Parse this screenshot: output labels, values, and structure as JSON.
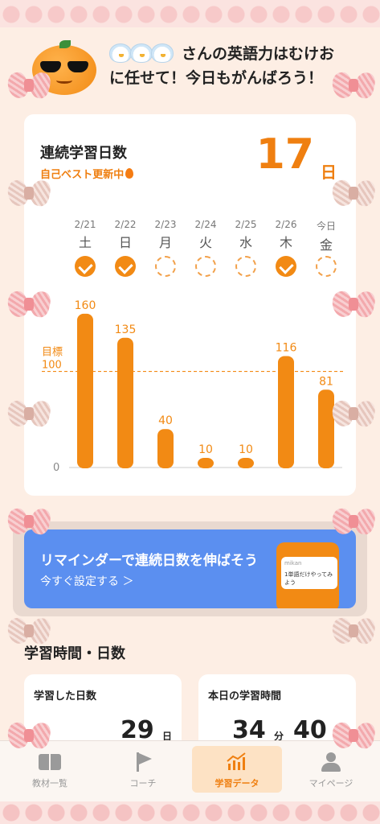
{
  "header": {
    "greeting_line1": "さんの英語力はむけお",
    "greeting_line2": "に任せて！今日もがんばろう！"
  },
  "streak": {
    "title": "連続学習日数",
    "subtitle": "自己ベスト更新中",
    "count": "17",
    "unit": "日",
    "days": [
      {
        "date": "2/21",
        "weekday": "土",
        "done": true
      },
      {
        "date": "2/22",
        "weekday": "日",
        "done": true
      },
      {
        "date": "2/23",
        "weekday": "月",
        "done": false
      },
      {
        "date": "2/24",
        "weekday": "火",
        "done": false
      },
      {
        "date": "2/25",
        "weekday": "水",
        "done": false
      },
      {
        "date": "2/26",
        "weekday": "木",
        "done": true
      },
      {
        "date": "今日",
        "weekday": "金",
        "done": false
      }
    ]
  },
  "chart_data": {
    "type": "bar",
    "categories": [
      "2/21",
      "2/22",
      "2/23",
      "2/24",
      "2/25",
      "2/26",
      "今日"
    ],
    "values": [
      160,
      135,
      40,
      10,
      10,
      116,
      81
    ],
    "goal_label": "目標",
    "goal_value": 100,
    "ytick_labels": [
      "0",
      "100"
    ],
    "ylim": [
      0,
      175
    ],
    "bar_color": "#f28a14",
    "goal_color": "#f28a14"
  },
  "reminder": {
    "title": "リマインダーで連続日数を伸ばそう",
    "link": "今すぐ設定する ＞",
    "phone_app": "mikan",
    "phone_text": "1単語だけやってみよう",
    "color": "#5b8ff0"
  },
  "study": {
    "section_title": "学習時間・日数",
    "days_label": "学習した日数",
    "days_value": "29",
    "days_unit": "日",
    "time_label": "本日の学習時間",
    "time_min": "34",
    "time_min_unit": "分",
    "time_sec": "40"
  },
  "tabs": [
    {
      "label": "教材一覧",
      "icon": "book-icon"
    },
    {
      "label": "コーチ",
      "icon": "flag-icon"
    },
    {
      "label": "学習データ",
      "icon": "chart-icon",
      "active": true
    },
    {
      "label": "マイページ",
      "icon": "user-icon"
    }
  ],
  "accent": "#ef7f10"
}
